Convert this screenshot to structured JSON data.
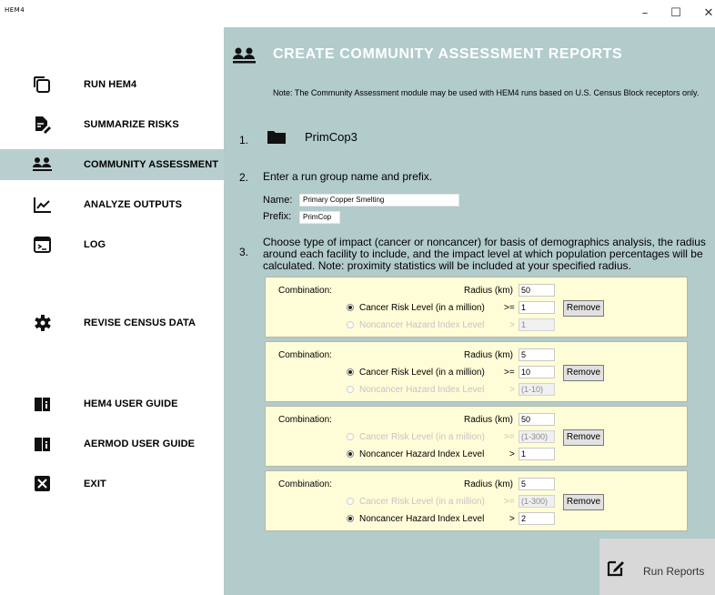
{
  "window": {
    "app_icon_text": "HEM4",
    "minimize_glyph": "–",
    "maximize_glyph": "☐",
    "close_glyph": "✕"
  },
  "sidebar": {
    "items": [
      {
        "label": "RUN HEM4",
        "icon": "copy-icon",
        "active": false
      },
      {
        "label": "SUMMARIZE RISKS",
        "icon": "edit-document-icon",
        "active": false
      },
      {
        "label": "COMMUNITY ASSESSMENT",
        "icon": "community-icon",
        "active": true
      },
      {
        "label": "ANALYZE OUTPUTS",
        "icon": "line-chart-icon",
        "active": false
      },
      {
        "label": "LOG",
        "icon": "terminal-icon",
        "active": false
      },
      {
        "label": "REVISE CENSUS DATA",
        "icon": "gear-icon",
        "active": false
      },
      {
        "label": "HEM4 USER GUIDE",
        "icon": "book-icon",
        "active": false
      },
      {
        "label": "AERMOD USER GUIDE",
        "icon": "book-icon",
        "active": false
      },
      {
        "label": "EXIT",
        "icon": "close-box-icon",
        "active": false
      }
    ]
  },
  "main": {
    "title": "CREATE COMMUNITY ASSESSMENT REPORTS",
    "note": "Note: The Community Assessment module may be used with HEM4 runs based on U.S. Census Block receptors only.",
    "step1": {
      "number": "1.",
      "folder_name": "PrimCop3"
    },
    "step2": {
      "number": "2.",
      "text": "Enter a run group name and prefix.",
      "name_label": "Name:",
      "name_value": "Primary Copper Smelting",
      "prefix_label": "Prefix:",
      "prefix_value": "PrimCop"
    },
    "step3": {
      "number": "3.",
      "text": "Choose type of impact (cancer or noncancer) for basis of demographics analysis, the radius around each facility to include, and the impact level at which population percentages will be calculated. Note: proximity statistics will be included at your specified radius."
    },
    "combination_label": "Combination:",
    "radius_label": "Radius (km)",
    "cancer_label": "Cancer Risk Level (in a million)",
    "noncancer_label": "Noncancer Hazard Index Level",
    "cancer_op": ">=",
    "noncancer_op": ">",
    "remove_label": "Remove",
    "combinations": [
      {
        "radius": "50",
        "cancer_selected": true,
        "cancer_value": "1",
        "noncancer_value": "1"
      },
      {
        "radius": "5",
        "cancer_selected": true,
        "cancer_value": "10",
        "noncancer_value": "(1-10)"
      },
      {
        "radius": "50",
        "cancer_selected": false,
        "cancer_value": "(1-300)",
        "noncancer_value": "1"
      },
      {
        "radius": "5",
        "cancer_selected": false,
        "cancer_value": "(1-300)",
        "noncancer_value": "2"
      }
    ],
    "run_reports_label": "Run Reports"
  }
}
